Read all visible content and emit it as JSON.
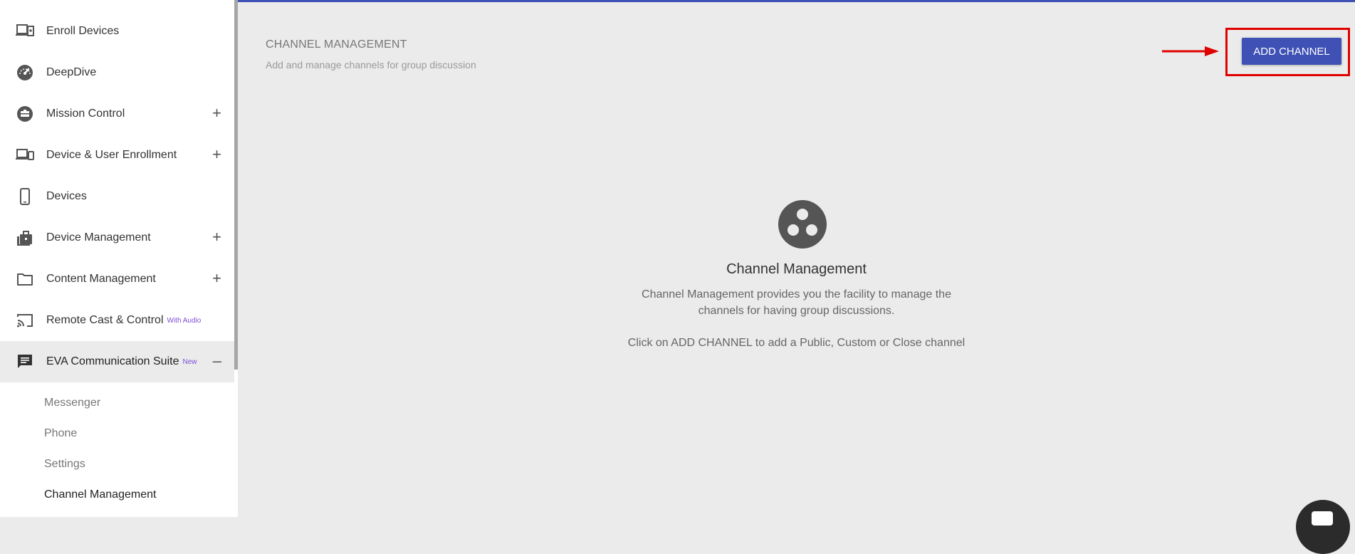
{
  "sidebar": {
    "items": [
      {
        "label": "Enroll Devices",
        "icon": "enroll-devices-icon",
        "expand": ""
      },
      {
        "label": "DeepDive",
        "icon": "speedometer-icon",
        "expand": ""
      },
      {
        "label": "Mission Control",
        "icon": "mission-control-icon",
        "expand": "+"
      },
      {
        "label": "Device & User Enrollment",
        "icon": "devices-icon",
        "expand": "+"
      },
      {
        "label": "Devices",
        "icon": "smartphone-icon",
        "expand": ""
      },
      {
        "label": "Device Management",
        "icon": "briefcase-icon",
        "expand": "+"
      },
      {
        "label": "Content Management",
        "icon": "folder-icon",
        "expand": "+"
      },
      {
        "label": "Remote Cast & Control",
        "icon": "cast-icon",
        "badge": "With Audio",
        "expand": ""
      },
      {
        "label": "EVA Communication Suite",
        "icon": "chat-icon",
        "badge": "New",
        "expand": "–"
      }
    ],
    "subitems": [
      "Messenger",
      "Phone",
      "Settings",
      "Channel Management"
    ]
  },
  "header": {
    "title": "CHANNEL MANAGEMENT",
    "subtitle": "Add and manage channels for group discussion",
    "add_button": "ADD CHANNEL"
  },
  "empty_state": {
    "icon": "group-circles-icon",
    "title": "Channel Management",
    "desc_line1": "Channel Management provides you the facility to manage the",
    "desc_line2": "channels for having group discussions.",
    "hint": "Click on ADD CHANNEL to add a Public, Custom or Close channel"
  },
  "colors": {
    "accent": "#3f51b5",
    "annotation": "#e00000",
    "badge": "#7b4fd6"
  }
}
